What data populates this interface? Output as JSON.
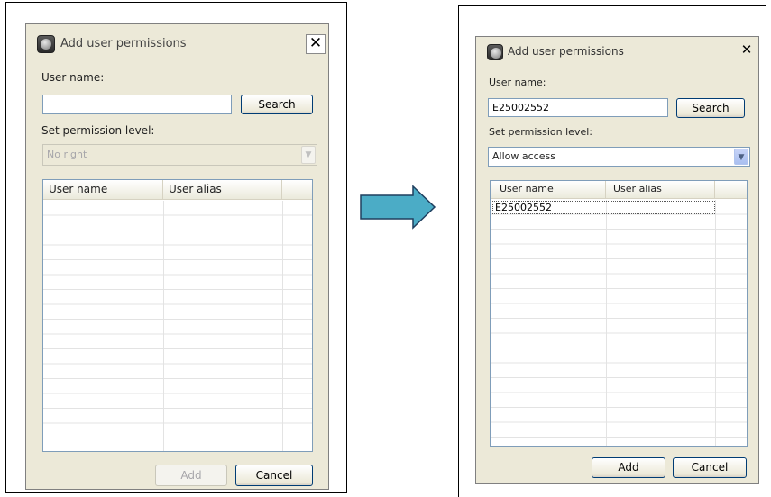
{
  "before": {
    "dialog_title": "Add user permissions",
    "user_name_label": "User name:",
    "user_name_value": "",
    "search_label": "Search",
    "permission_label": "Set permission level:",
    "permission_value": "No right",
    "columns": [
      "User name",
      "User alias"
    ],
    "rows": [],
    "add_label": "Add",
    "cancel_label": "Cancel",
    "add_enabled": false,
    "permission_enabled": false
  },
  "after": {
    "dialog_title": "Add user permissions",
    "user_name_label": "User name:",
    "user_name_value": "E25002552",
    "search_label": "Search",
    "permission_label": "Set permission level:",
    "permission_value": "Allow access",
    "columns": [
      "User name",
      "User alias"
    ],
    "rows": [
      {
        "user_name": "E25002552",
        "user_alias": ""
      }
    ],
    "add_label": "Add",
    "cancel_label": "Cancel",
    "add_enabled": true,
    "permission_enabled": true
  },
  "icons": {
    "app": "app-logo-icon",
    "close": "close-icon",
    "dropdown": "chevron-down-icon",
    "transition": "right-arrow-icon"
  },
  "colors": {
    "dialog_bg": "#ece9d8",
    "arrow_fill": "#4bacc6"
  }
}
